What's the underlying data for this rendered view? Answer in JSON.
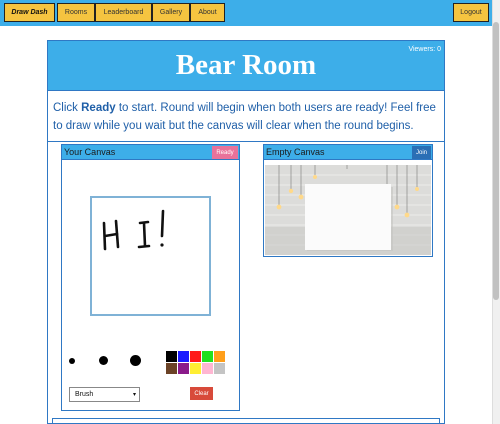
{
  "nav": {
    "brand": "Draw Dash",
    "rooms": "Rooms",
    "leaderboard": "Leaderboard",
    "gallery": "Gallery",
    "about": "About",
    "logout": "Logout"
  },
  "room": {
    "title": "Bear Room",
    "viewers": "Viewers: 0",
    "instructions_prefix": "Click ",
    "instructions_bold": "Ready",
    "instructions_suffix": " to start. Round will begin when both users are ready! Feel free to draw while you wait but the canvas will clear when the round begins."
  },
  "your_canvas": {
    "title": "Your Canvas",
    "ready_label": "Ready",
    "drawing_text": "HI!",
    "brush_sizes": [
      "small",
      "medium",
      "large"
    ],
    "colors": [
      "#000000",
      "#1a1aff",
      "#ff1a1a",
      "#22e01e",
      "#ff9f1a",
      "#6b4226",
      "#8a1a8a",
      "#ffee33",
      "#ffb6d2",
      "#c4c4c4"
    ],
    "tool_selected": "Brush",
    "clear_label": "Clear"
  },
  "empty_canvas": {
    "title": "Empty Canvas",
    "join_label": "Join"
  },
  "theme": {
    "header_blue": "#3daee9",
    "border_blue": "#2f78c4",
    "nav_button_yellow": "#f5c440",
    "ready_pink": "#e8729a",
    "join_blue": "#2b6fb5",
    "clear_red": "#d84a3a"
  }
}
